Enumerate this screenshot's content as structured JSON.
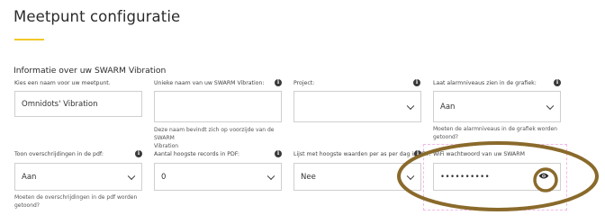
{
  "page": {
    "title": "Meetpunt configuratie",
    "section_title": "Informatie over uw SWARM Vibration"
  },
  "fields": {
    "name": {
      "label": "Kies een naam voor uw meetpunt.",
      "value": "Omnidots' Vibration"
    },
    "unique_name": {
      "label": "Unieke naam van uw SWARM Vibration:",
      "value": "",
      "help_line1": "Deze naam bevindt zich op voorzijde van de SWARM",
      "help_line2": "Vibration"
    },
    "project": {
      "label": "Project:",
      "value": ""
    },
    "alarm_levels": {
      "label": "Laat alarmniveaus zien in de grafiek:",
      "value": "Aan",
      "help_line1": "Moeten de alarmniveaus in de grafiek worden",
      "help_line2": "getoond?"
    },
    "exceedances_pdf": {
      "label": "Toon overschrijdingen in de pdf:",
      "value": "Aan",
      "help_line1": "Moeten de overschrijdingen in de pdf worden",
      "help_line2": "getoond?"
    },
    "highest_records": {
      "label": "Aantal hoogste records in PDF:",
      "value": "0"
    },
    "highest_per_day": {
      "label": "Lijst met hoogste waarden per as per dag in PDF:",
      "value": "Nee"
    },
    "wifi_password": {
      "label": "WiFi wachtwoord van uw SWARM",
      "value": "••••••••••"
    }
  },
  "icons": {
    "info": "info-icon",
    "chevron": "chevron-down-icon",
    "eye": "eye-icon"
  },
  "colors": {
    "accent": "#f3c829",
    "annotation": "#8a6a2b",
    "highlight": "#f5b7ea"
  }
}
